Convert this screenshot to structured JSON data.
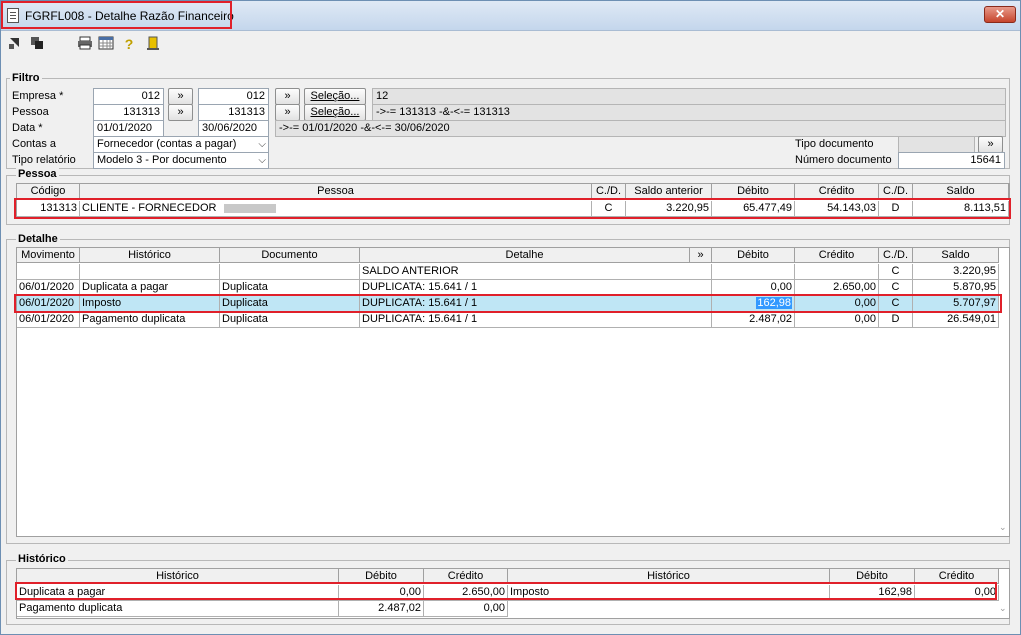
{
  "window": {
    "title": "FGRFL008 - Detalhe Razão Financeiro",
    "close_glyph": "✕"
  },
  "toolbar": {
    "icons": [
      "export-icon",
      "copy-icon",
      "print-icon",
      "calendar-grid-icon",
      "help-icon",
      "exit-door-icon"
    ]
  },
  "filtro": {
    "title": "Filtro",
    "empresa_label": "Empresa *",
    "empresa_from": "012",
    "empresa_to": "012",
    "pessoa_label": "Pessoa",
    "pessoa_from": "131313",
    "pessoa_to": "131313",
    "data_label": "Data *",
    "data_from": "01/01/2020",
    "data_to": "30/06/2020",
    "contas_label": "Contas a",
    "contas_value": "Fornecedor (contas a pagar)",
    "tipo_relatorio_label": "Tipo relatório",
    "tipo_relatorio_value": "Modelo 3 - Por documento",
    "range_button": "»",
    "selecao_label": "Seleção...",
    "empresa_selecao_text": "12",
    "pessoa_selecao_text": "->-= 131313 -&-<-= 131313",
    "data_selecao_text": "->-= 01/01/2020 -&-<-= 30/06/2020",
    "tipo_documento_label": "Tipo documento",
    "tipo_documento_value": "",
    "numero_documento_label": "Número documento",
    "numero_documento_value": "15641"
  },
  "pessoa": {
    "title": "Pessoa",
    "columns": [
      "Código",
      "Pessoa",
      "C./D.",
      "Saldo anterior",
      "Débito",
      "Crédito",
      "C./D.",
      "Saldo"
    ],
    "row": {
      "codigo": "131313",
      "pessoa": "CLIENTE - FORNECEDOR",
      "cd1": "C",
      "saldo_anterior": "3.220,95",
      "debito": "65.477,49",
      "credito": "54.143,03",
      "cd2": "D",
      "saldo": "8.113,51"
    }
  },
  "detalhe": {
    "title": "Detalhe",
    "columns": [
      "Movimento",
      "Histórico",
      "Documento",
      "Detalhe",
      "»",
      "Débito",
      "Crédito",
      "C./D.",
      "Saldo"
    ],
    "rows": [
      {
        "movimento": "",
        "historico": "",
        "documento": "",
        "detalhe": "SALDO ANTERIOR",
        "debito": "",
        "credito": "",
        "cd": "C",
        "saldo": "3.220,95"
      },
      {
        "movimento": "06/01/2020",
        "historico": "Duplicata a pagar",
        "documento": "Duplicata",
        "detalhe": "DUPLICATA: 15.641 / 1",
        "debito": "0,00",
        "credito": "2.650,00",
        "cd": "C",
        "saldo": "5.870,95"
      },
      {
        "movimento": "06/01/2020",
        "historico": "Imposto",
        "documento": "Duplicata",
        "detalhe": "DUPLICATA: 15.641 / 1",
        "debito": "162,98",
        "credito": "0,00",
        "cd": "C",
        "saldo": "5.707,97"
      },
      {
        "movimento": "06/01/2020",
        "historico": "Pagamento duplicata",
        "documento": "Duplicata",
        "detalhe": "DUPLICATA: 15.641 / 1",
        "debito": "2.487,02",
        "credito": "0,00",
        "cd": "D",
        "saldo": "26.549,01"
      }
    ]
  },
  "historico": {
    "title": "Histórico",
    "left_columns": [
      "Histórico",
      "Débito",
      "Crédito"
    ],
    "left_rows": [
      {
        "historico": "Duplicata a pagar",
        "debito": "0,00",
        "credito": "2.650,00"
      },
      {
        "historico": "Pagamento duplicata",
        "debito": "2.487,02",
        "credito": "0,00"
      }
    ],
    "right_columns": [
      "Histórico",
      "Débito",
      "Crédito"
    ],
    "right_rows": [
      {
        "historico": "Imposto",
        "debito": "162,98",
        "credito": "0,00"
      }
    ]
  },
  "colors": {
    "highlight": "#e0202a",
    "selected_row": "#bfe6f5",
    "selected_cell": "#3399ff"
  }
}
